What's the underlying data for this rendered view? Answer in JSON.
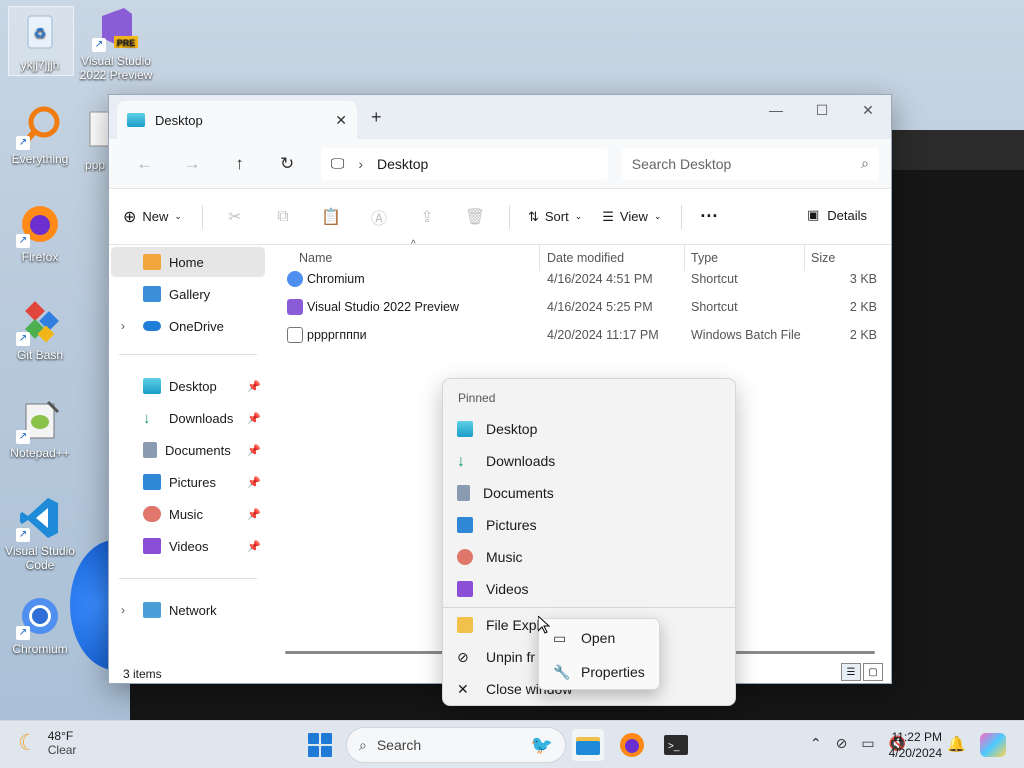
{
  "desktop": {
    "icons": [
      {
        "label": "ykjj7jjjh"
      },
      {
        "label": "Visual Studio 2022 Preview",
        "badge": "PRE"
      },
      {
        "label": "Everything"
      },
      {
        "label": "ppp"
      },
      {
        "label": "Firefox"
      },
      {
        "label": "Git Bash"
      },
      {
        "label": "Notepad++"
      },
      {
        "label": "Visual Studio Code"
      },
      {
        "label": "Chromium"
      }
    ]
  },
  "explorer": {
    "tab_title": "Desktop",
    "address": "Desktop",
    "search_placeholder": "Search Desktop",
    "toolbar": {
      "new": "New",
      "sort": "Sort",
      "view": "View",
      "details": "Details"
    },
    "nav": {
      "home": "Home",
      "gallery": "Gallery",
      "onedrive": "OneDrive",
      "desktop": "Desktop",
      "downloads": "Downloads",
      "documents": "Documents",
      "pictures": "Pictures",
      "music": "Music",
      "videos": "Videos",
      "network": "Network"
    },
    "columns": {
      "name": "Name",
      "date": "Date modified",
      "type": "Type",
      "size": "Size"
    },
    "files": [
      {
        "name": "Chromium",
        "date": "4/16/2024 4:51 PM",
        "type": "Shortcut",
        "size": "3 KB"
      },
      {
        "name": "Visual Studio 2022 Preview",
        "date": "4/16/2024 5:25 PM",
        "type": "Shortcut",
        "size": "2 KB"
      },
      {
        "name": "ppppгпппи",
        "date": "4/20/2024 11:17 PM",
        "type": "Windows Batch File",
        "size": "2 KB"
      }
    ],
    "status": "3 items"
  },
  "jumplist": {
    "header": "Pinned",
    "items": [
      "Desktop",
      "Downloads",
      "Documents",
      "Pictures",
      "Music",
      "Videos"
    ],
    "file_explorer": "File Expl",
    "unpin": "Unpin fr",
    "close": "Close window"
  },
  "context_menu": {
    "open": "Open",
    "properties": "Properties"
  },
  "taskbar": {
    "temp": "48°F",
    "condition": "Clear",
    "search": "Search",
    "time": "11:22 PM",
    "date": "4/20/2024"
  }
}
